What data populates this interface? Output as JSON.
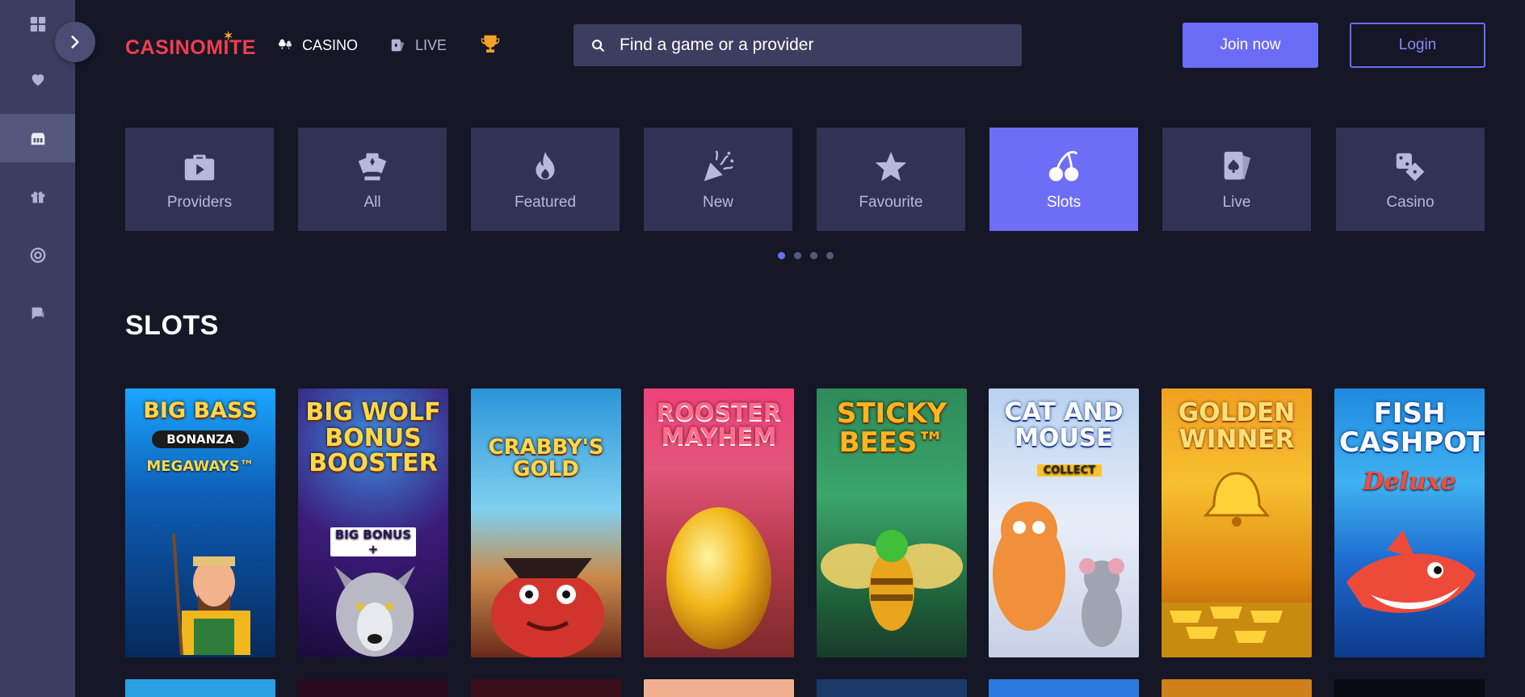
{
  "header": {
    "logo_text": "CASINOMITE",
    "nav": {
      "casino": "CASINO",
      "live": "LIVE"
    },
    "search_placeholder": "Find a game or a provider",
    "join_label": "Join now",
    "login_label": "Login"
  },
  "sidebar": {
    "icons": [
      "dashboard-icon",
      "heart-icon",
      "casino-icon",
      "gift-icon",
      "target-icon",
      "support-icon"
    ],
    "active_index": 2
  },
  "categories": [
    {
      "label": "Providers",
      "icon": "briefcase-play-icon"
    },
    {
      "label": "All",
      "icon": "cards-icon"
    },
    {
      "label": "Featured",
      "icon": "flame-icon"
    },
    {
      "label": "New",
      "icon": "party-popper-icon"
    },
    {
      "label": "Favourite",
      "icon": "star-icon"
    },
    {
      "label": "Slots",
      "icon": "cherries-icon",
      "active": true
    },
    {
      "label": "Live",
      "icon": "playing-cards-icon"
    },
    {
      "label": "Casino",
      "icon": "dice-icon"
    }
  ],
  "pagination": {
    "pages": 4,
    "active": 1
  },
  "section_title": "SLOTS",
  "games": [
    {
      "title": "BIG BASS",
      "subtitle": "BONANZA",
      "extra": "MEGAWAYS™"
    },
    {
      "title": "BIG WOLF BONUS BOOSTER",
      "subtitle": "BIG BONUS +"
    },
    {
      "title": "CRABBY'S GOLD"
    },
    {
      "title": "ROOSTER MAYHEM"
    },
    {
      "title": "STICKY BEES™"
    },
    {
      "title": "CAT AND MOUSE",
      "subtitle": "COLLECT"
    },
    {
      "title": "GOLDEN WINNER"
    },
    {
      "title": "FISH CASHPOT",
      "subtitle": "Deluxe"
    }
  ],
  "colors": {
    "accent": "#6b6cf6",
    "background": "#151626",
    "sidebar": "#3b3e5e",
    "tile": "#313354",
    "logo": "#f03e4f"
  }
}
